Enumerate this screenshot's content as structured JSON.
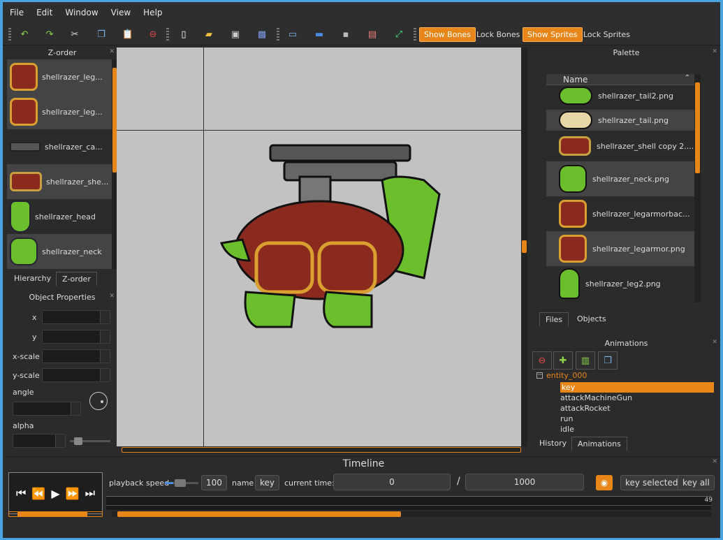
{
  "menu": [
    "File",
    "Edit",
    "Window",
    "View",
    "Help"
  ],
  "toolbar": {
    "show_bones": "Show Bones",
    "lock_bones": "Lock Bones",
    "show_sprites": "Show Sprites",
    "lock_sprites": "Lock Sprites"
  },
  "zorder": {
    "title": "Z-order",
    "items": [
      {
        "label": "shellrazer_leg..."
      },
      {
        "label": "shellrazer_leg..."
      },
      {
        "label": "shellrazer_ca..."
      },
      {
        "label": "shellrazer_she..."
      },
      {
        "label": "shellrazer_head"
      },
      {
        "label": "shellrazer_neck"
      }
    ],
    "tabs": [
      "Hierarchy",
      "Z-order"
    ]
  },
  "props": {
    "title": "Object Properties",
    "x": "x",
    "y": "y",
    "xscale": "x-scale",
    "yscale": "y-scale",
    "angle": "angle",
    "alpha": "alpha"
  },
  "palette": {
    "title": "Palette",
    "col": "Name",
    "items": [
      {
        "label": "shellrazer_tail2.png"
      },
      {
        "label": "shellrazer_tail.png"
      },
      {
        "label": "shellrazer_shell copy 2...."
      },
      {
        "label": "shellrazer_neck.png"
      },
      {
        "label": "shellrazer_legarmorbac..."
      },
      {
        "label": "shellrazer_legarmor.png"
      },
      {
        "label": "shellrazer_leg2.png"
      }
    ],
    "tabs": [
      "Files",
      "Objects"
    ]
  },
  "animations": {
    "title": "Animations",
    "entity": "entity_000",
    "items": [
      "key",
      "attackMachineGun",
      "attackRocket",
      "run",
      "idle"
    ],
    "tabs": [
      "History",
      "Animations"
    ]
  },
  "timeline": {
    "title": "Timeline",
    "playback_label": "playback speed",
    "playback_value": "100",
    "name_label": "name",
    "name_value": "key",
    "current_label": "current time:",
    "current_value": "0",
    "slash": "/",
    "total_value": "1000",
    "key_selected": "key selected",
    "key_all": "key all",
    "ruler_end": "49"
  },
  "colors": {
    "accent": "#e8861a",
    "panel": "#2b2b2b",
    "canvas": "#c2c2c2"
  }
}
